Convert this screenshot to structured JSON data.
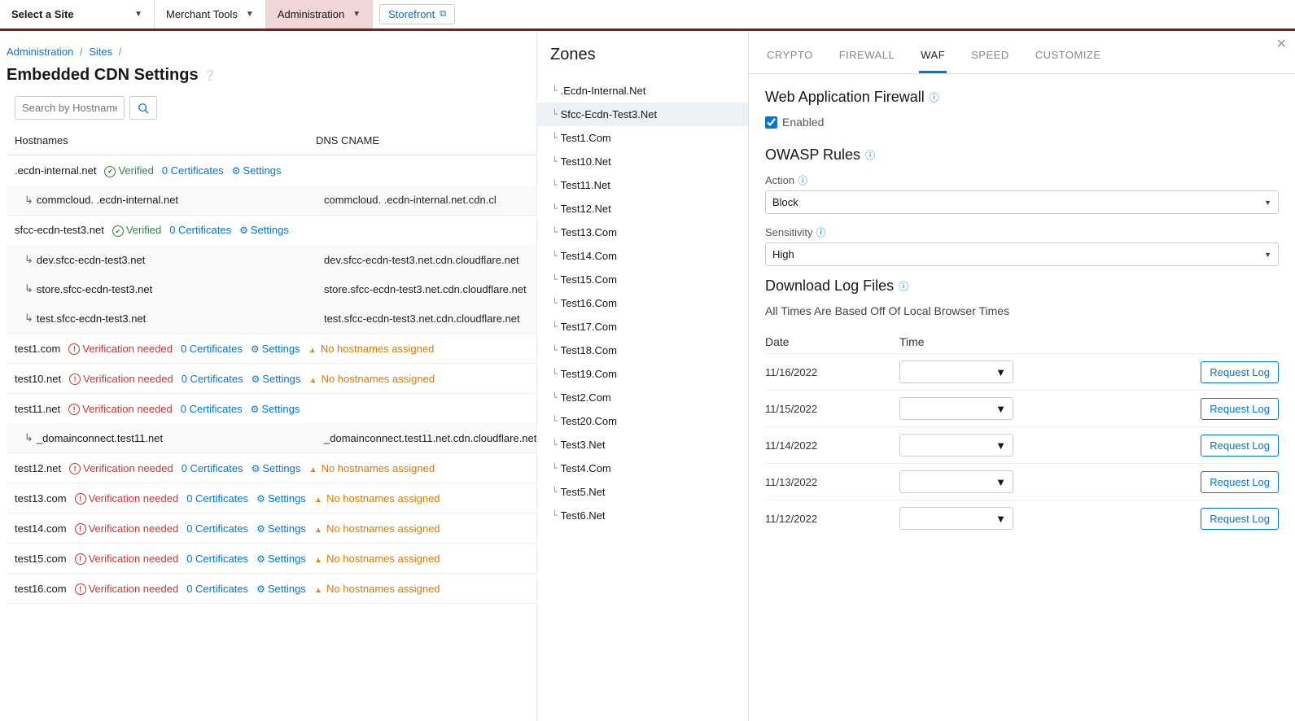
{
  "topbar": {
    "site_select": "Select a Site",
    "merchant_tools": "Merchant Tools",
    "administration": "Administration",
    "storefront": "Storefront"
  },
  "breadcrumb": {
    "admin": "Administration",
    "sites": "Sites"
  },
  "page_title": "Embedded CDN Settings",
  "search": {
    "placeholder": "Search by Hostname"
  },
  "columns": {
    "hostnames": "Hostnames",
    "dns_cname": "DNS CNAME"
  },
  "labels": {
    "verified": "Verified",
    "verification_needed": "Verification needed",
    "zero_certs": "0 Certificates",
    "settings": "Settings",
    "no_hostnames": "No hostnames assigned"
  },
  "hosts": [
    {
      "name": "            .ecdn-internal.net",
      "verified": true,
      "certs": true,
      "settings": true,
      "children": [
        {
          "name": "commcloud.              .ecdn-internal.net",
          "cname": "commcloud.              .ecdn-internal.net.cdn.cl"
        }
      ]
    },
    {
      "name": "sfcc-ecdn-test3.net",
      "verified": true,
      "certs": true,
      "settings": true,
      "children": [
        {
          "name": "dev.sfcc-ecdn-test3.net",
          "cname": "dev.sfcc-ecdn-test3.net.cdn.cloudflare.net"
        },
        {
          "name": "store.sfcc-ecdn-test3.net",
          "cname": "store.sfcc-ecdn-test3.net.cdn.cloudflare.net"
        },
        {
          "name": "test.sfcc-ecdn-test3.net",
          "cname": "test.sfcc-ecdn-test3.net.cdn.cloudflare.net"
        }
      ]
    },
    {
      "name": "test1.com",
      "vneeded": true,
      "certs": true,
      "settings": true,
      "warn": true
    },
    {
      "name": "test10.net",
      "vneeded": true,
      "certs": true,
      "settings": true,
      "warn": true
    },
    {
      "name": "test11.net",
      "vneeded": true,
      "certs": true,
      "settings": true,
      "children": [
        {
          "name": "_domainconnect.test11.net",
          "cname": "_domainconnect.test11.net.cdn.cloudflare.net"
        }
      ]
    },
    {
      "name": "test12.net",
      "vneeded": true,
      "certs": true,
      "settings": true,
      "warn": true
    },
    {
      "name": "test13.com",
      "vneeded": true,
      "certs": true,
      "settings": true,
      "warn": true
    },
    {
      "name": "test14.com",
      "vneeded": true,
      "certs": true,
      "settings": true,
      "warn": true
    },
    {
      "name": "test15.com",
      "vneeded": true,
      "certs": true,
      "settings": true,
      "warn": true
    },
    {
      "name": "test16.com",
      "vneeded": true,
      "certs": true,
      "settings": true,
      "warn": true
    }
  ],
  "zones": {
    "title": "Zones",
    "items": [
      {
        "label": "               .Ecdn-Internal.Net",
        "selected": false
      },
      {
        "label": "Sfcc-Ecdn-Test3.Net",
        "selected": true
      },
      {
        "label": "Test1.Com"
      },
      {
        "label": "Test10.Net"
      },
      {
        "label": "Test11.Net"
      },
      {
        "label": "Test12.Net"
      },
      {
        "label": "Test13.Com"
      },
      {
        "label": "Test14.Com"
      },
      {
        "label": "Test15.Com"
      },
      {
        "label": "Test16.Com"
      },
      {
        "label": "Test17.Com"
      },
      {
        "label": "Test18.Com"
      },
      {
        "label": "Test19.Com"
      },
      {
        "label": "Test2.Com"
      },
      {
        "label": "Test20.Com"
      },
      {
        "label": "Test3.Net"
      },
      {
        "label": "Test4.Com"
      },
      {
        "label": "Test5.Net"
      },
      {
        "label": "Test6.Net"
      }
    ]
  },
  "right": {
    "tabs": {
      "crypto": "CRYPTO",
      "firewall": "FIREWALL",
      "waf": "WAF",
      "speed": "SPEED",
      "customize": "CUSTOMIZE"
    },
    "waf_title": "Web Application Firewall",
    "enabled_label": "Enabled",
    "owasp_title": "OWASP Rules",
    "action_label": "Action",
    "action_value": "Block",
    "sensitivity_label": "Sensitivity",
    "sensitivity_value": "High",
    "download_title": "Download Log Files",
    "times_note": "All Times Are Based Off Of Local Browser Times",
    "date_h": "Date",
    "time_h": "Time",
    "request_log": "Request Log",
    "logs": [
      {
        "date": "11/16/2022"
      },
      {
        "date": "11/15/2022"
      },
      {
        "date": "11/14/2022"
      },
      {
        "date": "11/13/2022"
      },
      {
        "date": "11/12/2022"
      }
    ]
  }
}
